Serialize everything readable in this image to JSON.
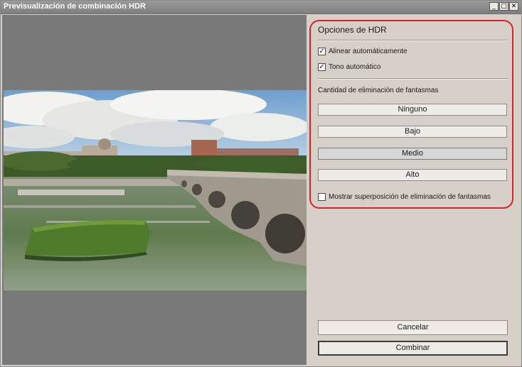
{
  "window": {
    "title": "Previsualización de combinación HDR",
    "controls": {
      "minimize": "_",
      "maximize": "□",
      "close": "✕"
    }
  },
  "panel": {
    "section_title": "Opciones de HDR",
    "auto_align": {
      "label": "Alinear automáticamente",
      "checked": true
    },
    "auto_tone": {
      "label": "Tono automático",
      "checked": true
    },
    "deghost_label": "Cantidad de eliminación de fantasmas",
    "deghost_options": [
      {
        "label": "Ninguno",
        "selected": false
      },
      {
        "label": "Bajo",
        "selected": false
      },
      {
        "label": "Medio",
        "selected": true
      },
      {
        "label": "Alto",
        "selected": false
      }
    ],
    "show_overlay": {
      "label": "Mostrar superposición de eliminación de fantasmas",
      "checked": false
    }
  },
  "actions": {
    "cancel_label": "Cancelar",
    "merge_label": "Combinar"
  },
  "colors": {
    "highlight": "#d8232a",
    "panel_bg": "#d6d0c8",
    "preview_bg": "#797979",
    "selected_button": "#d7d7d7"
  }
}
